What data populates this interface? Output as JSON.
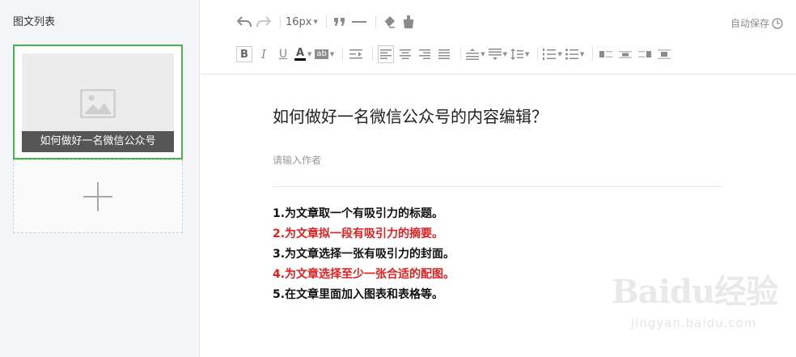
{
  "sidebar": {
    "title": "图文列表",
    "card": {
      "caption": "如何做好一名微信公众号",
      "thumb_icon": "image-placeholder-icon",
      "border_color": "#44b549"
    },
    "add_icon": "plus-icon"
  },
  "toolbar": {
    "row1": {
      "undo_icon": "undo-icon",
      "redo_icon": "redo-icon",
      "font_size": "16px",
      "quote_icon": "blockquote-icon",
      "hr_icon": "horizontal-rule-icon",
      "eraser_icon": "clear-format-icon",
      "format_painter_icon": "format-painter-icon"
    },
    "row2": {
      "bold": "B",
      "italic": "I",
      "underline": "U",
      "font_color": "A",
      "bg_color": "ab"
    },
    "autosave_label": "自动保存",
    "autosave_icon": "clock-icon"
  },
  "article": {
    "title": "如何做好一名微信公众号的内容编辑？",
    "author_placeholder": "请输入作者",
    "lines": [
      {
        "text": "1.为文章取一个有吸引力的标题。",
        "color": "#111111"
      },
      {
        "text": "2.为文章拟一段有吸引力的摘要。",
        "color": "#e02020"
      },
      {
        "text": "3.为文章选择一张有吸引力的封面。",
        "color": "#111111"
      },
      {
        "text": "4.为文章选择至少一张合适的配图。",
        "color": "#e02020"
      },
      {
        "text": "5.在文章里面加入图表和表格等。",
        "color": "#111111"
      }
    ]
  },
  "watermark": {
    "main": "Baidu经验",
    "url": "jingyan.baidu.com"
  }
}
